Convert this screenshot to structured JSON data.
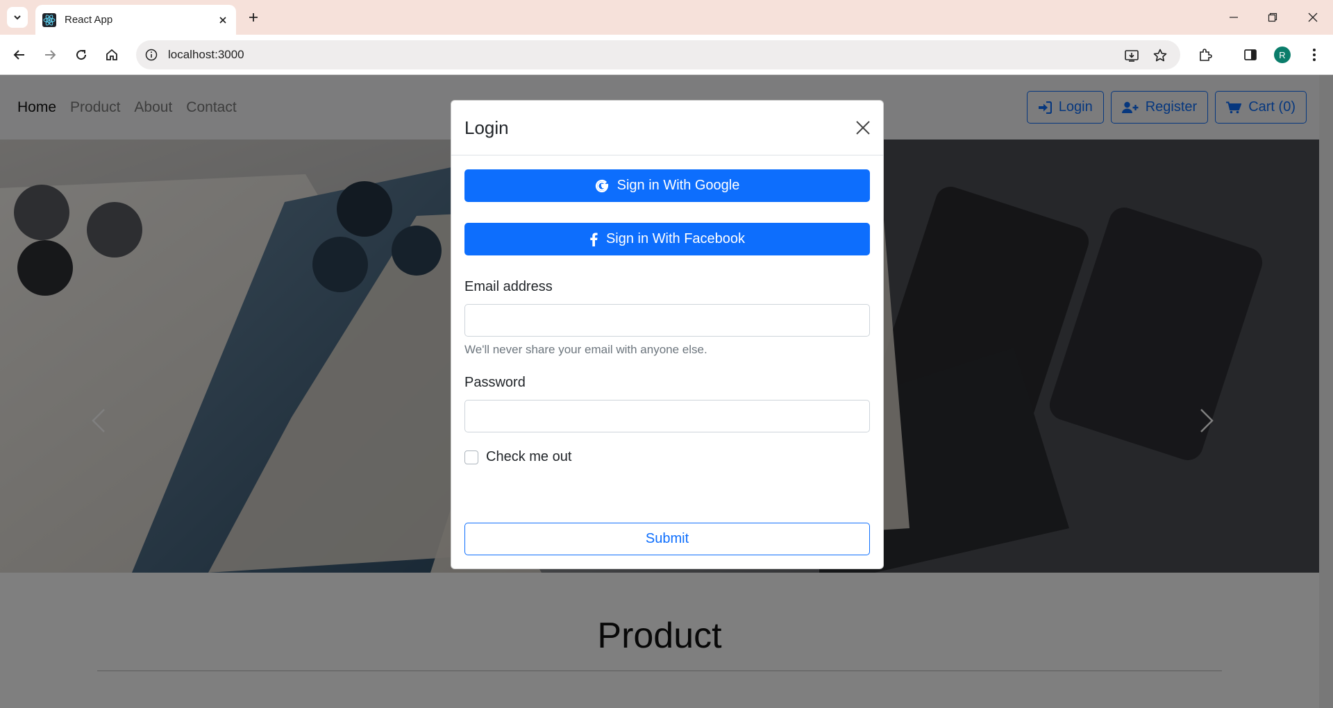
{
  "browser": {
    "tab_title": "React App",
    "url": "localhost:3000",
    "avatar_letter": "R"
  },
  "navbar": {
    "links": [
      "Home",
      "Product",
      "About",
      "Contact"
    ],
    "login_label": "Login",
    "register_label": "Register",
    "cart_label": "Cart (0)"
  },
  "section": {
    "title": "Product"
  },
  "modal": {
    "title": "Login",
    "google_label": "Sign in With Google",
    "facebook_label": "Sign in With Facebook",
    "email_label": "Email address",
    "email_value": "",
    "email_help": "We'll never share your email with anyone else.",
    "password_label": "Password",
    "password_value": "",
    "check_label": "Check me out",
    "submit_label": "Submit"
  },
  "colors": {
    "primary": "#0d6efd",
    "tabbar": "#f6e1da",
    "avatar": "#0b7d6b"
  }
}
